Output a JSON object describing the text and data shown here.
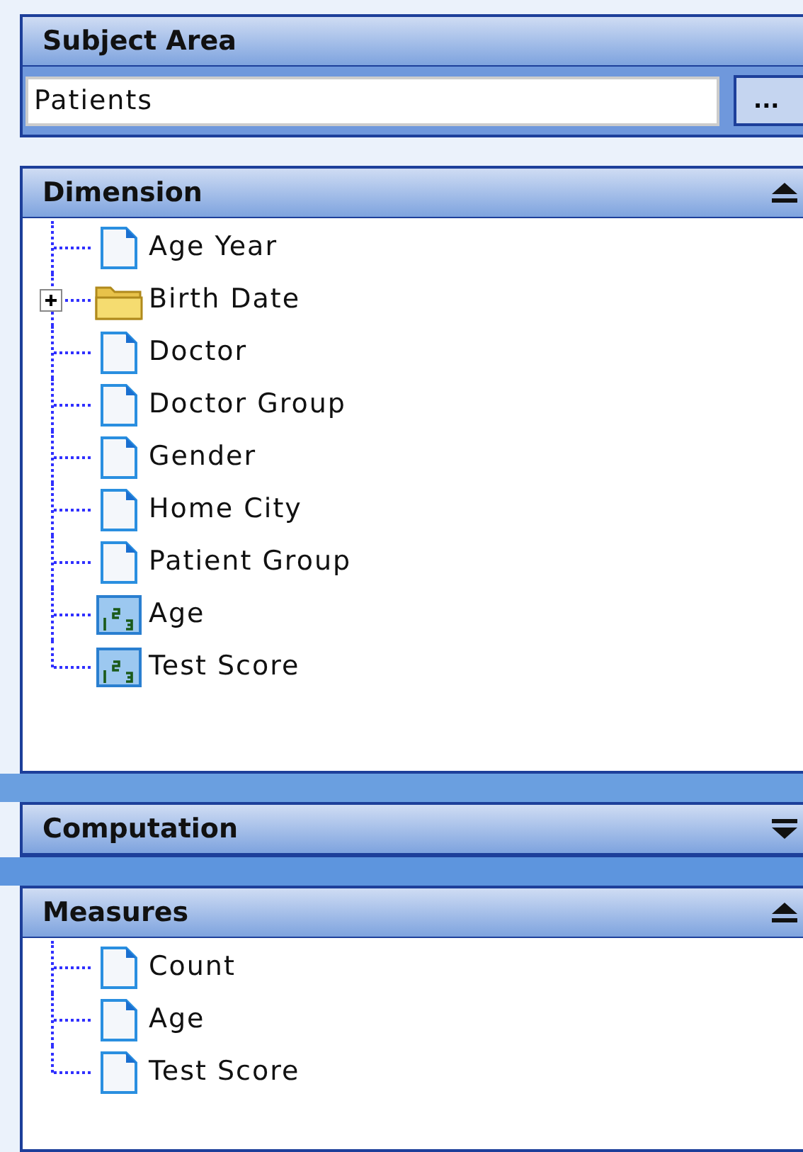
{
  "subject_area": {
    "title": "Subject Area",
    "value": "Patients",
    "button": "..."
  },
  "sections": [
    {
      "title": "Dimension",
      "expanded": true,
      "items": [
        {
          "label": "Age Year",
          "kind": "field"
        },
        {
          "label": "Birth Date",
          "kind": "folder",
          "expanded": false
        },
        {
          "label": "Doctor",
          "kind": "field"
        },
        {
          "label": "Doctor Group",
          "kind": "field"
        },
        {
          "label": "Gender",
          "kind": "field"
        },
        {
          "label": "Home City",
          "kind": "field"
        },
        {
          "label": "Patient Group",
          "kind": "field"
        },
        {
          "label": "Age",
          "kind": "number"
        },
        {
          "label": "Test Score",
          "kind": "number"
        }
      ]
    },
    {
      "title": "Computation",
      "expanded": false
    },
    {
      "title": "Measures",
      "expanded": true,
      "items": [
        {
          "label": "Count",
          "kind": "field"
        },
        {
          "label": "Age",
          "kind": "field"
        },
        {
          "label": "Test Score",
          "kind": "field"
        }
      ]
    }
  ]
}
